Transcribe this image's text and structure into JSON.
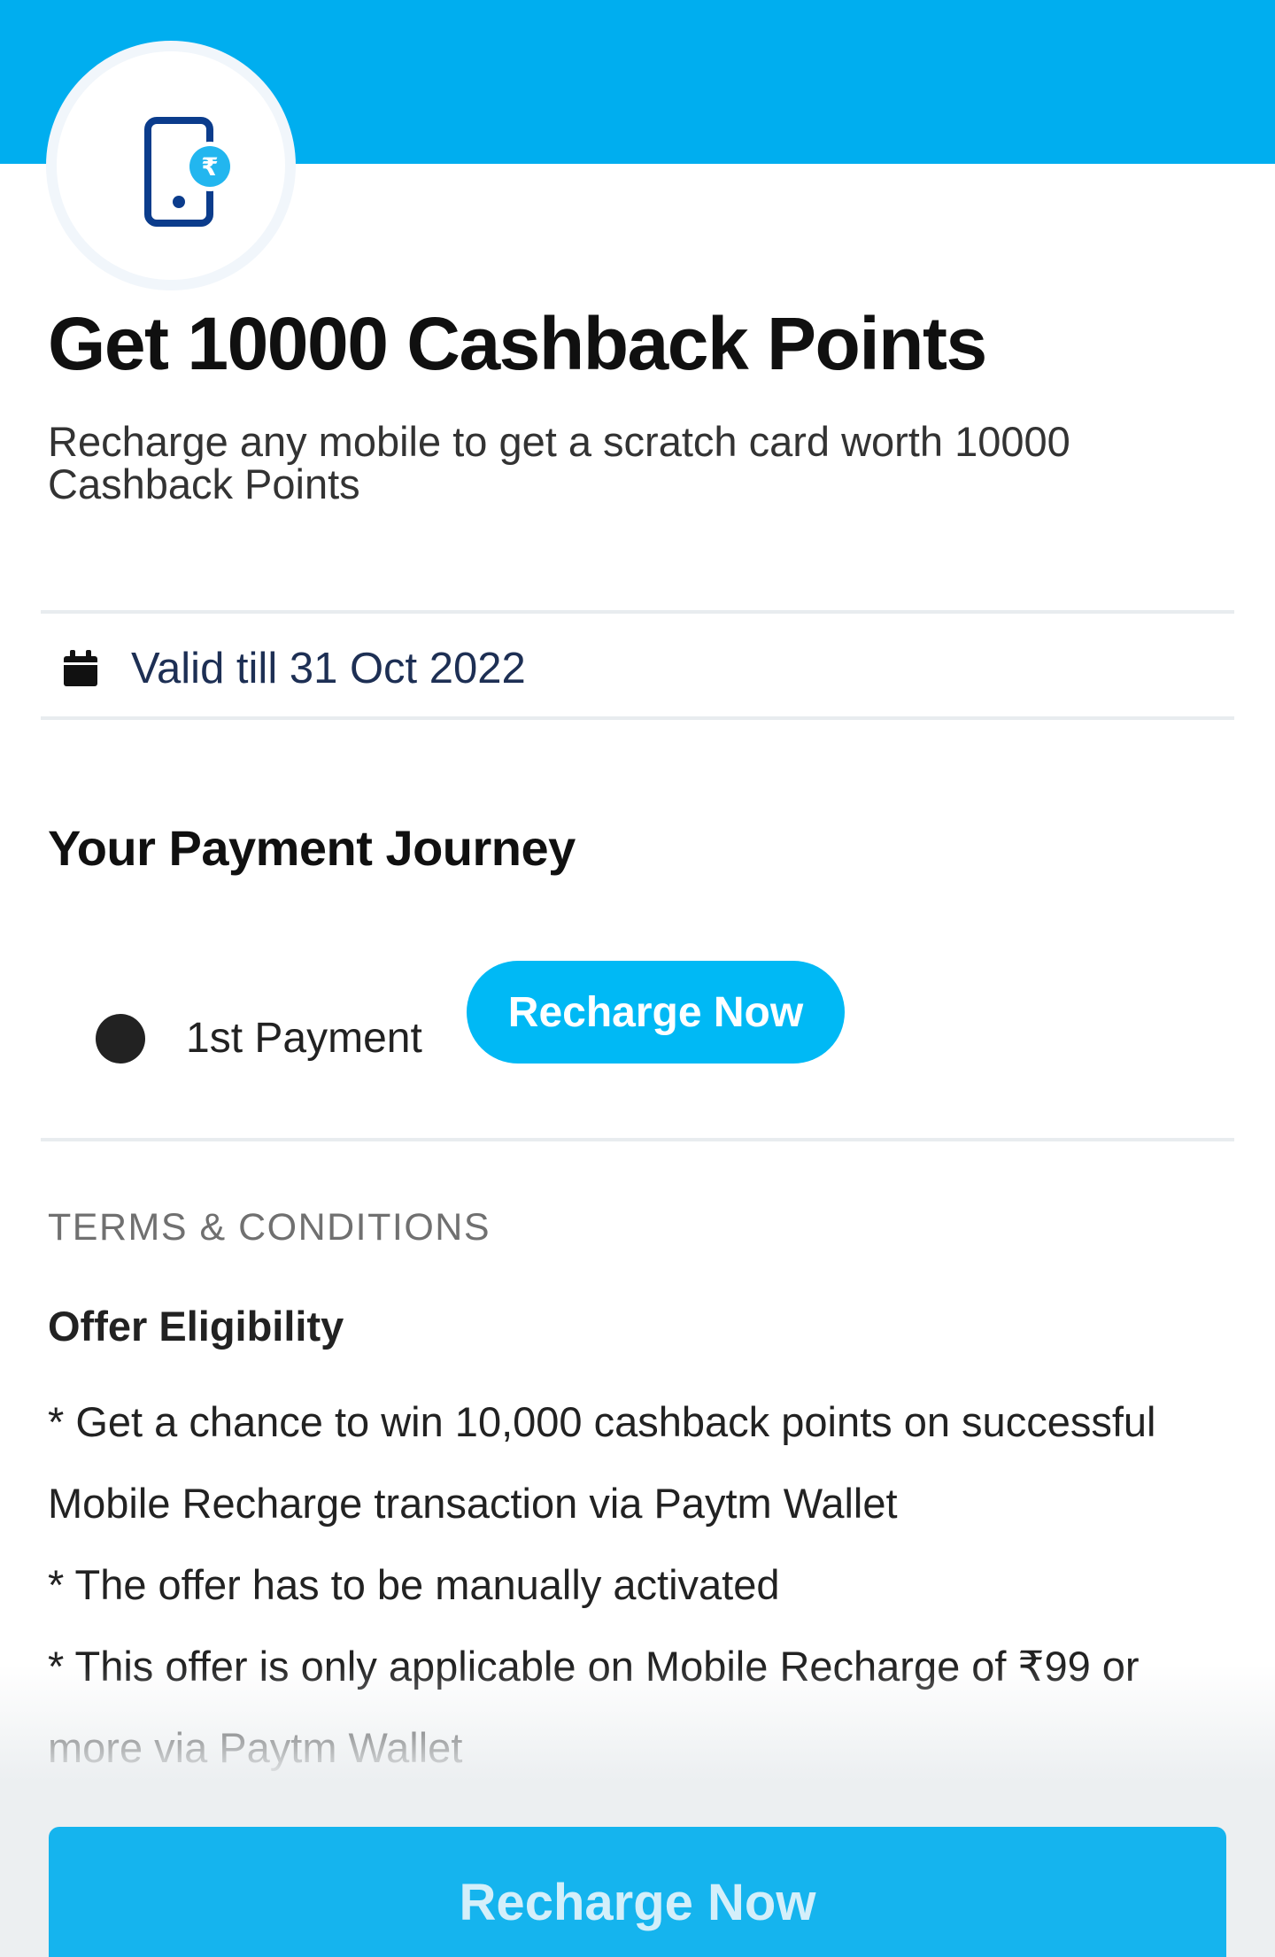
{
  "header": {
    "accent_color": "#00AEEF",
    "icon": "mobile-rupee-icon"
  },
  "offer": {
    "title": "Get 10000 Cashback Points",
    "subtitle": "Recharge any mobile to get a scratch card worth 10000 Cashback Points",
    "validity": {
      "icon": "calendar-icon",
      "text": "Valid till 31 Oct 2022"
    }
  },
  "journey": {
    "title": "Your Payment Journey",
    "steps": [
      {
        "label": "1st Payment",
        "action_label": "Recharge Now"
      }
    ]
  },
  "terms": {
    "heading": "TERMS & CONDITIONS",
    "eligibility_heading": "Offer Eligibility",
    "items": [
      "* Get a chance to win 10,000 cashback points on successful Mobile Recharge transaction via Paytm Wallet",
      "* The offer has to be manually activated",
      "* This offer is only applicable on Mobile Recharge of ₹99 or more via Paytm Wallet"
    ]
  },
  "footer": {
    "cta_label": "Recharge Now",
    "cta_color": "#15B4EE"
  }
}
